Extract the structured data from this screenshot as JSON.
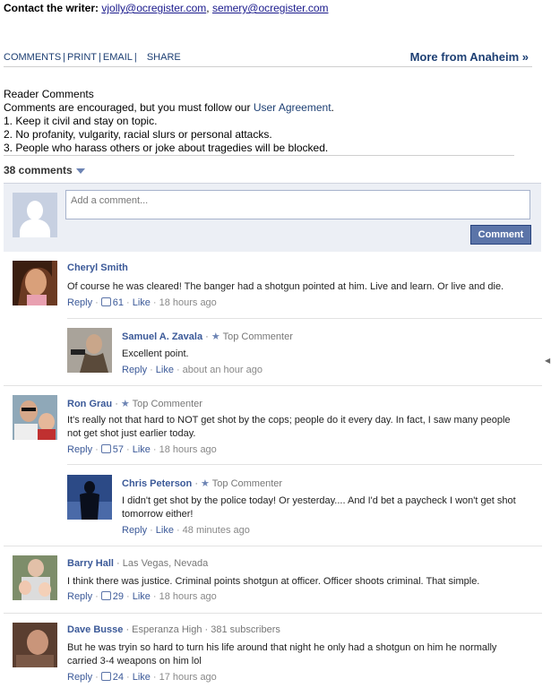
{
  "contact": {
    "label": "Contact the writer:",
    "email1": "vjolly@ocregister.com",
    "sep": ",",
    "email2": "semery@ocregister.com"
  },
  "toolbar": {
    "comments": "COMMENTS",
    "print": "PRINT",
    "email": "EMAIL",
    "share": "SHARE",
    "more": "More from Anaheim »"
  },
  "reader": {
    "title": "Reader Comments",
    "intro": "Comments are encouraged, but you must follow our",
    "agreement": "User Agreement",
    "period": ".",
    "rule1": "1. Keep it civil and stay on topic.",
    "rule2": "2. No profanity, vulgarity, racial slurs or personal attacks.",
    "rule3": "3. People who harass others or joke about tragedies will be blocked."
  },
  "comments_count": "38 comments",
  "composer": {
    "placeholder": "Add a comment...",
    "button": "Comment"
  },
  "comments": [
    {
      "name": "Cheryl Smith",
      "meta": "",
      "text": "Of course he was cleared! The banger had a shotgun pointed at him. Live and learn. Or live and die.",
      "reply": "Reply",
      "likes": "61",
      "like": "Like",
      "time": "18 hours ago"
    },
    {
      "name": "Samuel A. Zavala",
      "meta": "Top Commenter",
      "text": "Excellent point.",
      "reply": "Reply",
      "likes": "",
      "like": "Like",
      "time": "about an hour ago"
    },
    {
      "name": "Ron Grau",
      "meta": "Top Commenter",
      "text": "It's really not that hard to NOT get shot by the cops; people do it every day. In fact, I saw many people not get shot just earlier today.",
      "reply": "Reply",
      "likes": "57",
      "like": "Like",
      "time": "18 hours ago"
    },
    {
      "name": "Chris Peterson",
      "meta": "Top Commenter",
      "text": "I didn't get shot by the police today! Or yesterday.... And I'd bet a paycheck I won't get shot tomorrow either!",
      "reply": "Reply",
      "likes": "",
      "like": "Like",
      "time": "48 minutes ago"
    },
    {
      "name": "Barry Hall",
      "meta": "Las Vegas, Nevada",
      "text": "I think there was justice. Criminal points shotgun at officer. Officer shoots criminal. That simple.",
      "reply": "Reply",
      "likes": "29",
      "like": "Like",
      "time": "18 hours ago"
    },
    {
      "name": "Dave Busse",
      "meta": "Esperanza High · 381 subscribers",
      "text": "But he was tryin so hard to turn his life around that night he only had a shotgun on him he normally carried 3-4 weapons on him lol",
      "reply": "Reply",
      "likes": "24",
      "like": "Like",
      "time": "17 hours ago"
    }
  ],
  "colors": {
    "link": "#3b5998",
    "button": "#5b74a8",
    "composer_bg": "#eceff5"
  }
}
